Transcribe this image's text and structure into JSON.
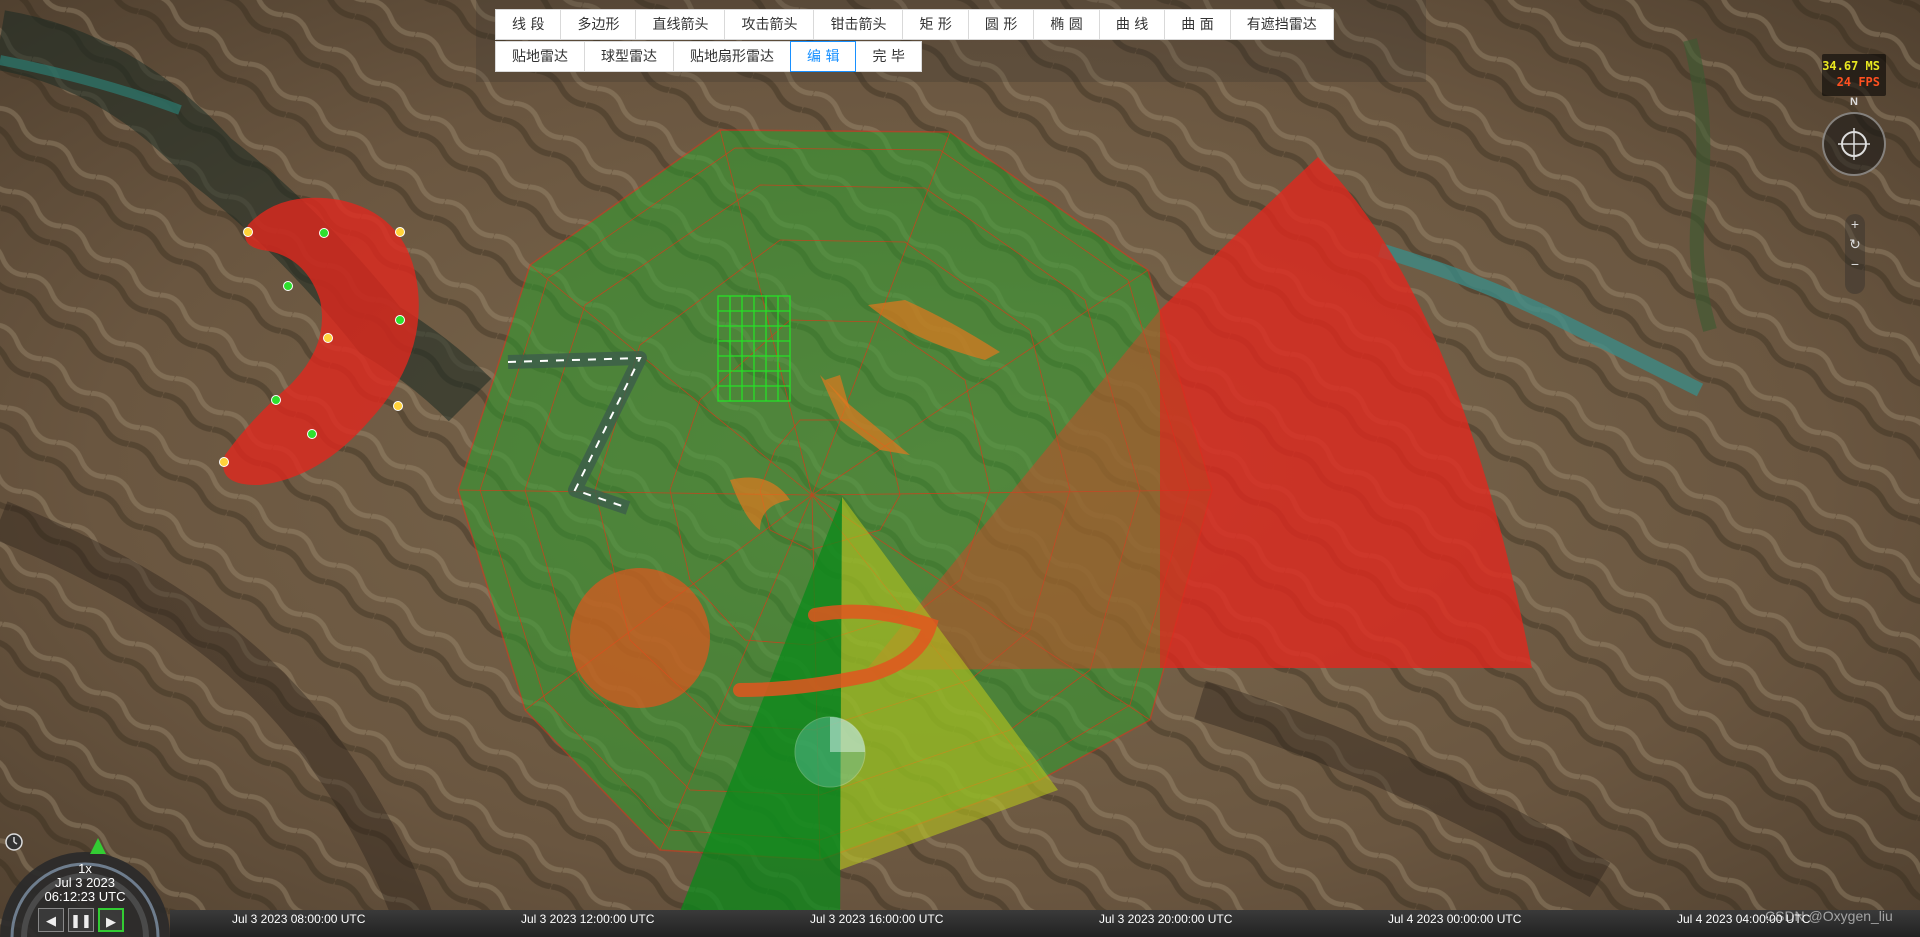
{
  "toolbar": {
    "row1": [
      "线 段",
      "多边形",
      "直线箭头",
      "攻击箭头",
      "钳击箭头",
      "矩 形",
      "圆 形",
      "椭 圆",
      "曲 线",
      "曲 面",
      "有遮挡雷达"
    ],
    "row2": [
      "贴地雷达",
      "球型雷达",
      "贴地扇形雷达",
      "编 辑",
      "完 毕"
    ],
    "active": "编 辑"
  },
  "fps": {
    "ms": "34.67 MS",
    "fps": "24 FPS"
  },
  "navigation": {
    "north_label": "N",
    "zoom_in": "+",
    "reset": "↻",
    "zoom_out": "−"
  },
  "clock": {
    "speed": "1x",
    "date": "Jul 3 2023",
    "time": "06:12:23 UTC",
    "buttons": {
      "reverse": "◀",
      "pause": "❚❚",
      "play": "▶"
    }
  },
  "timeline": {
    "ticks": [
      "Jul 3 2023 08:00:00 UTC",
      "Jul 3 2023 12:00:00 UTC",
      "Jul 3 2023 16:00:00 UTC",
      "Jul 3 2023 20:00:00 UTC",
      "Jul 4 2023 00:00:00 UTC",
      "Jul 4 2023 04:00:00 UTC"
    ]
  },
  "watermark": "CSDN @Oxygen_liu",
  "colors": {
    "red_fill": "#e0281e",
    "green_fill": "#2ea02e",
    "grid_line": "#d83a1a",
    "active_button": "#1890ff"
  }
}
